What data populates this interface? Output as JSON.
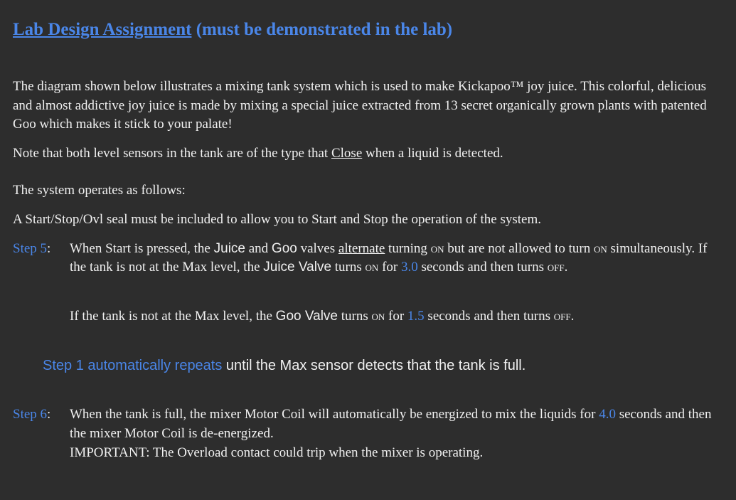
{
  "title": {
    "main": "Lab Design Assignment",
    "sub": " (must be demonstrated in the lab)"
  },
  "intro1a": "The diagram shown below illustrates a mixing tank system which is used to make Kickapoo",
  "intro1tm": "™",
  "intro1b": " joy juice. This colorful, delicious and almost addictive joy juice is made by mixing a special juice extracted from 13 secret organically grown plants with patented Goo which makes it stick to your palate!",
  "note_pre": "Note that both level sensors in the tank are of the type that ",
  "note_close": "Close",
  "note_post": " when a liquid is detected.",
  "operates": "The system operates as follows:",
  "startstop": "A Start/Stop/Ovl seal must be included to allow you to Start and Stop the operation of the system.",
  "step5": {
    "label": "Step 5",
    "colon": ":",
    "t1": "When Start is pressed, the ",
    "juice": "Juice",
    "t2": " and ",
    "goo": "Goo",
    "t3": " valves ",
    "alternate": "alternate",
    "t4": " turning ",
    "on1": "on",
    "t5": " but are not allowed to turn ",
    "on2": "on",
    "t6": " simultaneously. If the tank is not at the Max level, the ",
    "juice_valve": "Juice Valve",
    "t7": " turns ",
    "on3": "on",
    "t8": " for ",
    "num_a": "3.0",
    "t9": " seconds and then turns ",
    "off1": "off",
    "t10": ".",
    "s2a": "If the tank is not at the Max level, the ",
    "goo_valve": "Goo Valve",
    "s2b": " turns ",
    "on4": "on",
    "s2c": " for ",
    "num_b": "1.5",
    "s2d": " seconds and then turns ",
    "off2": "off",
    "s2e": "."
  },
  "repeat": {
    "a": "Step 1 automatically repeats",
    "b": " until the ",
    "max": "Max",
    "c": " sensor detects that the tank is full."
  },
  "step6": {
    "label": "Step 6",
    "colon": ":",
    "t1": "When the tank is full, the mixer Motor Coil will automatically be energized to mix the liquids for ",
    "num": "4.0",
    "t2": " seconds and then the mixer Motor Coil is de-energized.",
    "imp": "IMPORTANT:  The Overload contact could trip when the mixer is operating."
  }
}
